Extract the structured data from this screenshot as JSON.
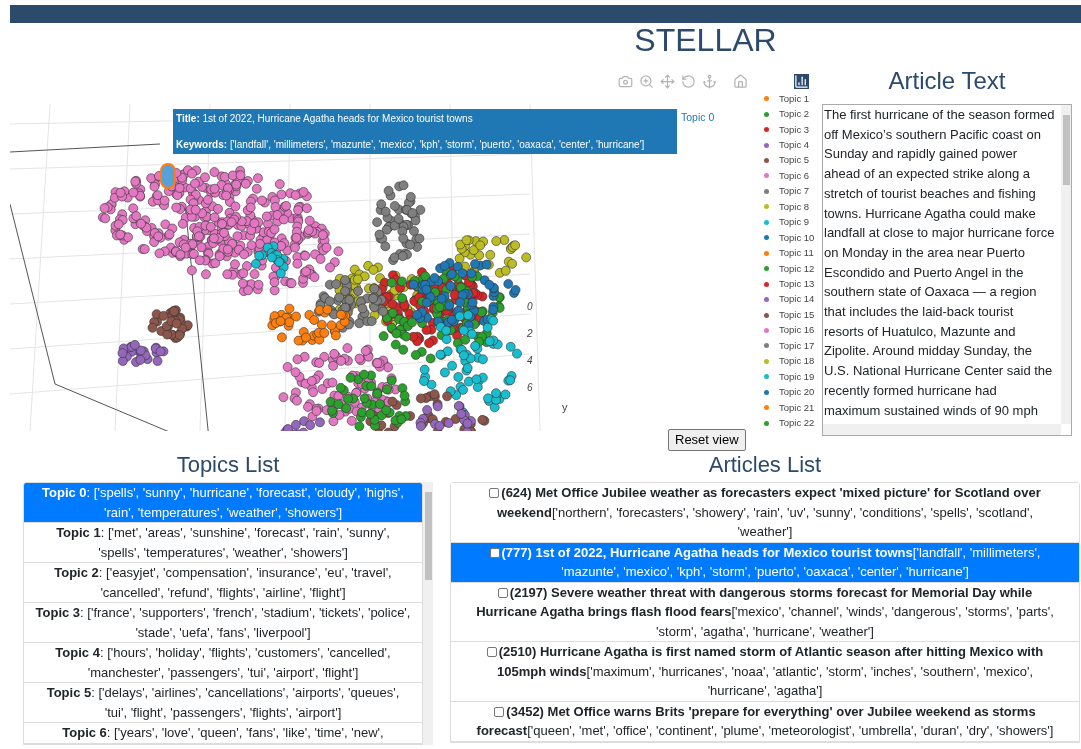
{
  "app_title": "STELLAR",
  "plot": {
    "hover": {
      "title_line": "**Title:** 1st of 2022, Hurricane Agatha heads for Mexico tourist towns",
      "keywords_line": "**Keywords:** ['landfall', 'millimeters', 'mazunte', 'mexico', 'kph', 'storm', 'puerto', 'oaxaca', 'center', 'hurricane']",
      "trace": "Topic 0",
      "color": "#1f77b4"
    },
    "axis_ticks": [
      "0",
      "2",
      "4",
      "6"
    ],
    "axis_label": "y",
    "legend": [
      {
        "label": "Topic 1",
        "color": "#ff7f0e"
      },
      {
        "label": "Topic 2",
        "color": "#2ca02c"
      },
      {
        "label": "Topic 3",
        "color": "#d62728"
      },
      {
        "label": "Topic 4",
        "color": "#9467bd"
      },
      {
        "label": "Topic 5",
        "color": "#8c564b"
      },
      {
        "label": "Topic 6",
        "color": "#e377c2"
      },
      {
        "label": "Topic 7",
        "color": "#7f7f7f"
      },
      {
        "label": "Topic 8",
        "color": "#bcbd22"
      },
      {
        "label": "Topic 9",
        "color": "#17becf"
      },
      {
        "label": "Topic 10",
        "color": "#1f77b4"
      },
      {
        "label": "Topic 11",
        "color": "#ff7f0e"
      },
      {
        "label": "Topic 12",
        "color": "#2ca02c"
      },
      {
        "label": "Topic 13",
        "color": "#d62728"
      },
      {
        "label": "Topic 14",
        "color": "#9467bd"
      },
      {
        "label": "Topic 15",
        "color": "#8c564b"
      },
      {
        "label": "Topic 16",
        "color": "#e377c2"
      },
      {
        "label": "Topic 17",
        "color": "#7f7f7f"
      },
      {
        "label": "Topic 18",
        "color": "#bcbd22"
      },
      {
        "label": "Topic 19",
        "color": "#17becf"
      },
      {
        "label": "Topic 20",
        "color": "#1f77b4"
      },
      {
        "label": "Topic 21",
        "color": "#ff7f0e"
      },
      {
        "label": "Topic 22",
        "color": "#2ca02c"
      }
    ],
    "reset_button": "Reset view"
  },
  "article": {
    "heading": "Article Text",
    "text": "The first hurricane of the season formed off Mexico’s southern Pacific coast on Sunday and rapidly gained power ahead of an expected strike along a stretch of tourist beaches and fishing towns. Hurricane Agatha could make landfall at close to major hurricane force on Monday in the area near Puerto Escondido and Puerto Angel in the southern state of Oaxaca — a region that includes the laid-back tourist resorts of Huatulco, Mazunte and Zipolite. Around midday Sunday, the U.S. National Hurricane Center said the recently formed hurricane had maximum sustained winds of 90 mph"
  },
  "topics": {
    "heading": "Topics List",
    "items": [
      {
        "text": "**Topic 0**: ['spells', 'sunny', 'hurricane', 'forecast', 'cloudy', 'highs', 'rain', 'temperatures', 'weather', 'showers']",
        "selected": true
      },
      {
        "text": "**Topic 1**: ['met', 'areas', 'sunshine', 'forecast', 'rain', 'sunny', 'spells', 'temperatures', 'weather', 'showers']",
        "selected": false
      },
      {
        "text": "**Topic 2**: ['easyjet', 'compensation', 'insurance', 'eu', 'travel', 'cancelled', 'refund', 'flights', 'airline', 'flight']",
        "selected": false
      },
      {
        "text": "**Topic 3**: ['france', 'supporters', 'french', 'stadium', 'tickets', 'police', 'stade', 'uefa', 'fans', 'liverpool']",
        "selected": false
      },
      {
        "text": "**Topic 4**: ['hours', 'holiday', 'flights', 'customers', 'cancelled', 'manchester', 'passengers', 'tui', 'airport', 'flight']",
        "selected": false
      },
      {
        "text": "**Topic 5**: ['delays', 'airlines', 'cancellations', 'airports', 'queues', 'tui', 'flight', 'passengers', 'flights', 'airport']",
        "selected": false
      },
      {
        "text": "**Topic 6**: ['years', 'love', 'queen', 'fans', 'like', 'time', 'new',",
        "selected": false
      }
    ]
  },
  "articles": {
    "heading": "Articles List",
    "items": [
      {
        "text": "**(624) Met Office Jubilee weather as forecasters expect 'mixed picture' for Scotland over weekend**['northern', 'forecasters', 'showery', 'rain', 'uv', 'sunny', 'conditions', 'spells', 'scotland', 'weather']",
        "checked": false,
        "selected": false
      },
      {
        "text": "**(777) 1st of 2022, Hurricane Agatha heads for Mexico tourist towns**['landfall', 'millimeters', 'mazunte', 'mexico', 'kph', 'storm', 'puerto', 'oaxaca', 'center', 'hurricane']",
        "checked": false,
        "selected": true
      },
      {
        "text": "**(2197) Severe weather threat with dangerous storms forecast for Memorial Day while Hurricane Agatha brings flash flood fears**['mexico', 'channel', 'winds', 'dangerous', 'storms', 'parts', 'storm', 'agatha', 'hurricane', 'weather']",
        "checked": false,
        "selected": false
      },
      {
        "text": "**(2510) Hurricane Agatha is first named storm of Atlantic season after hitting Mexico with 105mph winds**['maximum', 'hurricanes', 'noaa', 'atlantic', 'storm', 'inches', 'southern', 'mexico', 'hurricane', 'agatha']",
        "checked": false,
        "selected": false
      },
      {
        "text": "**(3452) Met Office warns Brits 'prepare for everything' over Jubilee weekend as storms forecast**['queen', 'met', 'office', 'continent', 'plume', 'meteorologist', 'umbrella', 'duran', 'dry', 'showers']",
        "checked": false,
        "selected": false
      }
    ]
  }
}
